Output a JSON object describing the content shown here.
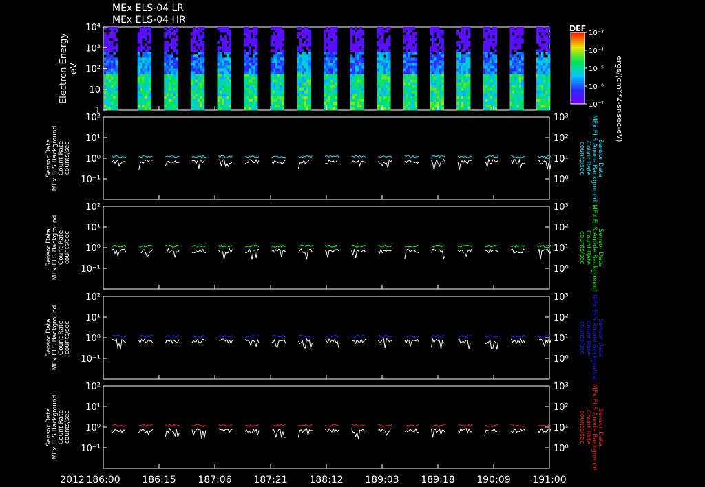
{
  "titles": [
    "MEx ELS-04 LR",
    "MEx ELS-04 HR"
  ],
  "x_axis": {
    "year": "2012",
    "tick_labels": [
      "186:00",
      "186:15",
      "187:06",
      "187:21",
      "188:12",
      "189:03",
      "189:18",
      "190:09",
      "191:00"
    ]
  },
  "colors": {
    "white": "#ffffff",
    "panel_colors": [
      "#00e5ff",
      "#00ff00",
      "#1f1fff",
      "#ff2020"
    ]
  },
  "colorbar": {
    "label": "DEF",
    "unit": "ergs/(cm**2-sr-sec-eV)",
    "ticks": [
      "10⁻³",
      "10⁻⁴",
      "10⁻⁵",
      "10⁻⁶",
      "10⁻⁷"
    ],
    "range": [
      1e-07,
      0.001
    ]
  },
  "chart_data": [
    {
      "type": "heatmap",
      "ylabel": [
        "Electron Energy",
        "eV"
      ],
      "y_scale": "log",
      "ylim": [
        1,
        10000
      ],
      "yticks": [
        "10⁴",
        "10³",
        "10²",
        "10",
        "1"
      ],
      "data_blocks": 17,
      "description_colormap": "rainbow (violet low → red high)"
    },
    {
      "type": "line",
      "ylabel_left": [
        "Sensor Data",
        "MEx ELS Background",
        "Count Rate",
        "counts/sec"
      ],
      "ylabel_right": [
        "Sensor Data",
        "MEx ELS Anode Background",
        "Count Rate",
        "counts/sec"
      ],
      "y_scale": "log",
      "ylim_left": [
        0.01,
        100
      ],
      "ylim_right": [
        0.1,
        1000
      ],
      "yticks_left": [
        "10²",
        "10¹",
        "10⁰",
        "10⁻¹"
      ],
      "yticks_right": [
        "10³",
        "10²",
        "10¹",
        "10⁰"
      ],
      "series": [
        {
          "name": "",
          "color": "#00e5ff",
          "level": 1.2
        },
        {
          "name": "",
          "color": "#ffffff",
          "level": 0.7
        }
      ]
    },
    {
      "type": "line",
      "ylabel_left": [
        "Sensor Data",
        "MEx ELS Background",
        "Count Rate",
        "counts/sec"
      ],
      "ylabel_right": [
        "Sensor Data",
        "MEx ELS Anode Background",
        "Count Rate",
        "counts/sec"
      ],
      "y_scale": "log",
      "ylim_left": [
        0.01,
        100
      ],
      "ylim_right": [
        0.1,
        1000
      ],
      "yticks_left": [
        "10²",
        "10¹",
        "10⁰",
        "10⁻¹"
      ],
      "yticks_right": [
        "10³",
        "10²",
        "10¹",
        "10⁰"
      ],
      "series": [
        {
          "name": "",
          "color": "#00ff00",
          "level": 1.2
        },
        {
          "name": "",
          "color": "#ffffff",
          "level": 0.7
        }
      ]
    },
    {
      "type": "line",
      "ylabel_left": [
        "Sensor Data",
        "MEx ELS Background",
        "Count Rate",
        "counts/sec"
      ],
      "ylabel_right": [
        "Sensor Data",
        "MEx ELS Anode Background",
        "Count Rate",
        "counts/sec"
      ],
      "y_scale": "log",
      "ylim_left": [
        0.01,
        100
      ],
      "ylim_right": [
        0.1,
        1000
      ],
      "yticks_left": [
        "10²",
        "10¹",
        "10⁰",
        "10⁻¹"
      ],
      "yticks_right": [
        "10³",
        "10²",
        "10¹",
        "10⁰"
      ],
      "series": [
        {
          "name": "",
          "color": "#1f1fff",
          "level": 1.2
        },
        {
          "name": "",
          "color": "#ffffff",
          "level": 0.7
        }
      ]
    },
    {
      "type": "line",
      "ylabel_left": [
        "Sensor Data",
        "MEx ELS Background",
        "Count Rate",
        "counts/sec"
      ],
      "ylabel_right": [
        "Sensor Data",
        "MEx ELS Anode Background",
        "Count Rate",
        "counts/sec"
      ],
      "y_scale": "log",
      "ylim_left": [
        0.01,
        100
      ],
      "ylim_right": [
        0.1,
        1000
      ],
      "yticks_left": [
        "10²",
        "10¹",
        "10⁰",
        "10⁻¹"
      ],
      "yticks_right": [
        "10³",
        "10²",
        "10¹",
        "10⁰"
      ],
      "series": [
        {
          "name": "",
          "color": "#ff2020",
          "level": 1.2
        },
        {
          "name": "",
          "color": "#ffffff",
          "level": 0.7
        }
      ]
    }
  ]
}
